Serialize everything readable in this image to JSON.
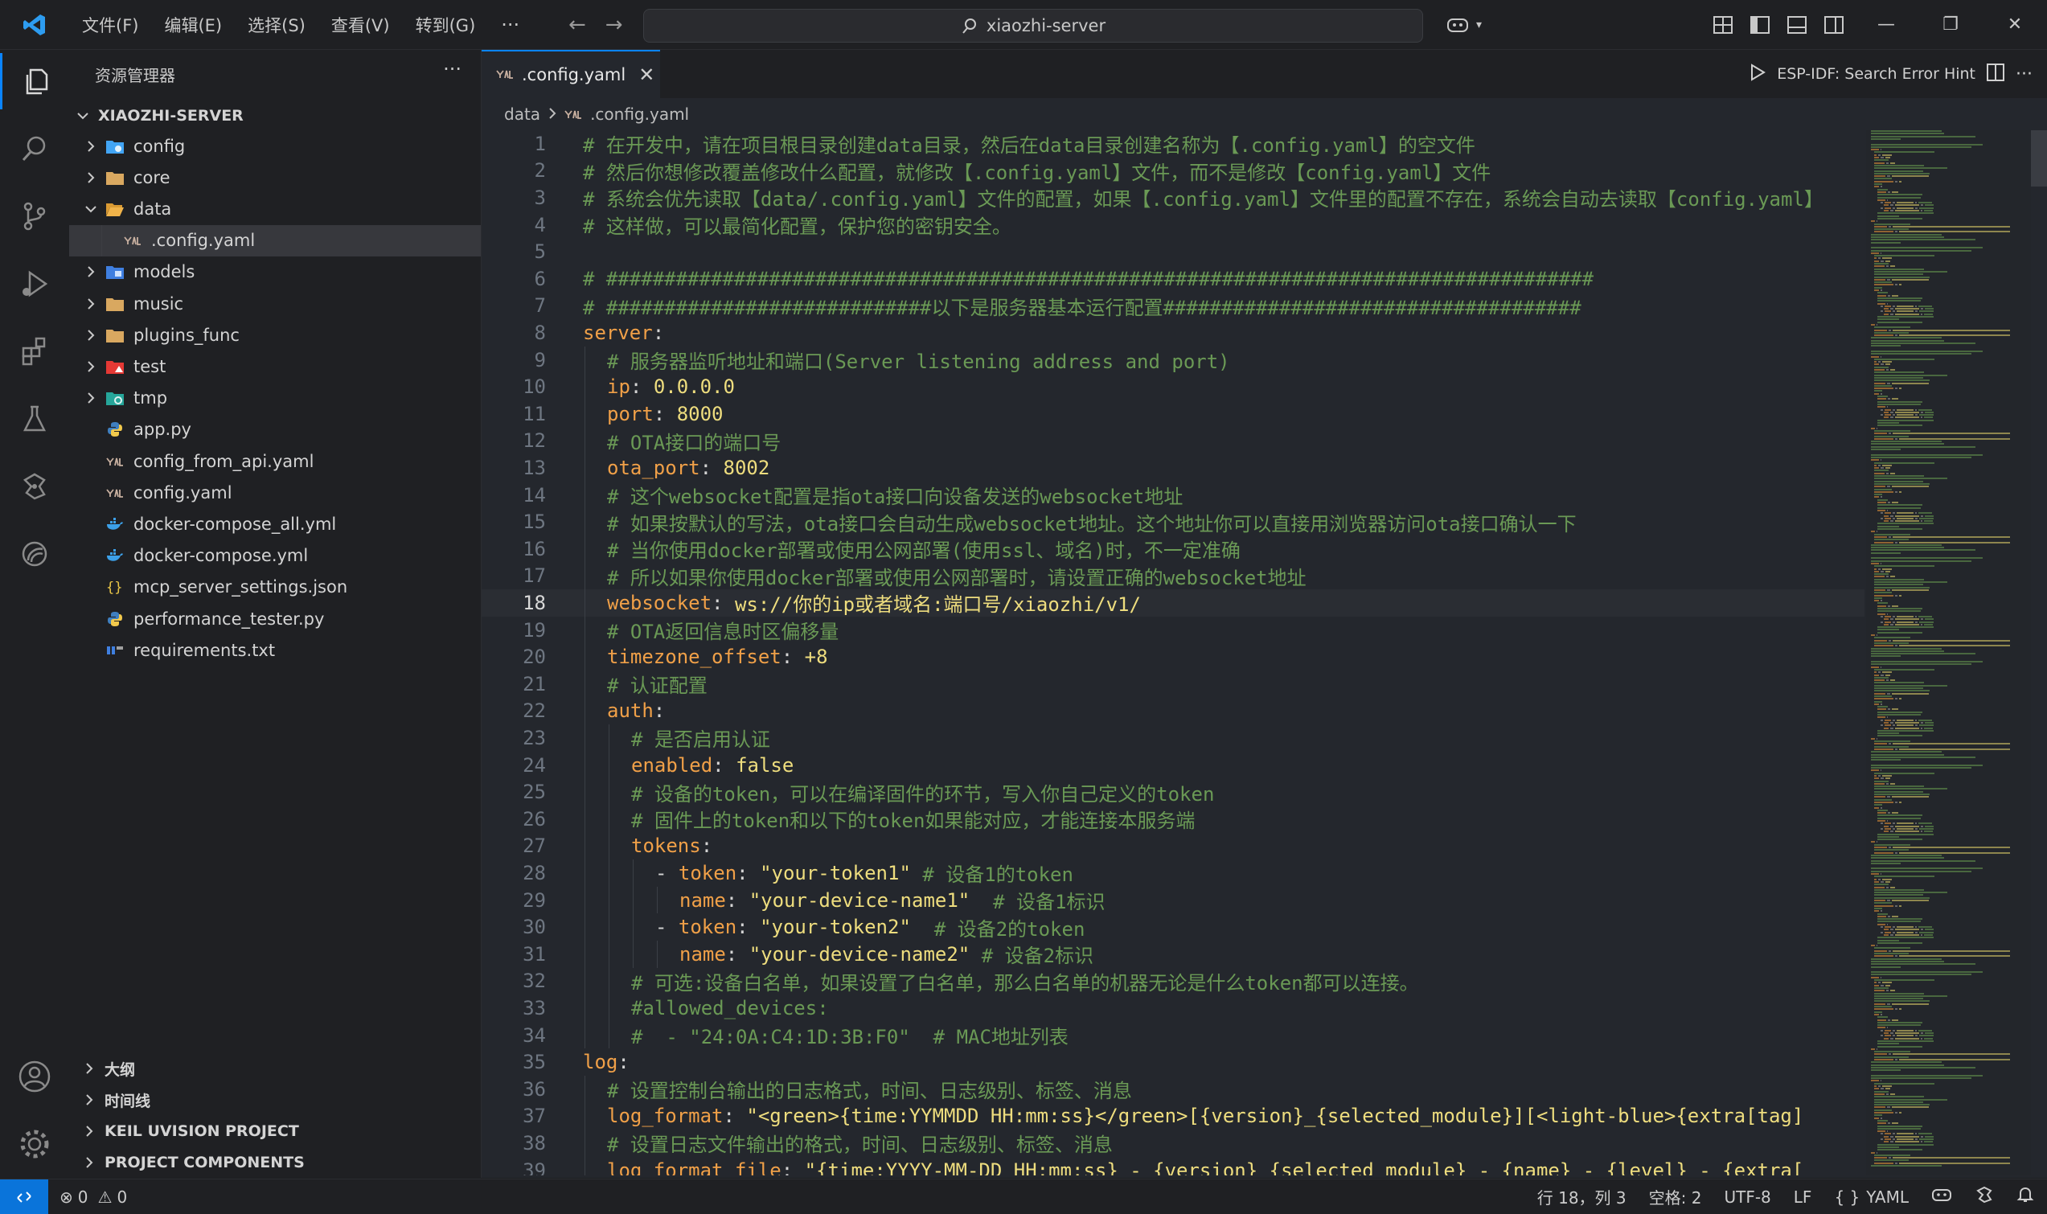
{
  "titlebar": {
    "menus": [
      "文件(F)",
      "编辑(E)",
      "选择(S)",
      "查看(V)",
      "转到(G)"
    ],
    "more": "···",
    "search_text": "xiaozhi-server"
  },
  "sidebar": {
    "title": "资源管理器",
    "more": "···",
    "root": "XIAOZHI-SERVER",
    "items": [
      {
        "label": "config",
        "kind": "folder",
        "icon": "config-folder-icon",
        "color": "#42a5f5",
        "expanded": false
      },
      {
        "label": "core",
        "kind": "folder",
        "icon": "folder-icon",
        "color": "#d9a860",
        "expanded": false
      },
      {
        "label": "data",
        "kind": "folder",
        "icon": "folder-open-icon",
        "color": "#f0b34a",
        "expanded": true
      },
      {
        "label": ".config.yaml",
        "kind": "yaml",
        "icon": "yaml-file-icon",
        "selected": true,
        "depth": 1
      },
      {
        "label": "models",
        "kind": "folder",
        "icon": "models-folder-icon",
        "color": "#3f7fe0",
        "expanded": false
      },
      {
        "label": "music",
        "kind": "folder",
        "icon": "folder-icon",
        "color": "#d9a860",
        "expanded": false
      },
      {
        "label": "plugins_func",
        "kind": "folder",
        "icon": "folder-icon",
        "color": "#d9a860",
        "expanded": false
      },
      {
        "label": "test",
        "kind": "folder",
        "icon": "test-folder-icon",
        "color": "#e53935",
        "expanded": false
      },
      {
        "label": "tmp",
        "kind": "folder",
        "icon": "tmp-folder-icon",
        "color": "#26a69a",
        "expanded": false
      },
      {
        "label": "app.py",
        "kind": "python",
        "icon": "python-file-icon"
      },
      {
        "label": "config_from_api.yaml",
        "kind": "yaml",
        "icon": "yaml-file-icon"
      },
      {
        "label": "config.yaml",
        "kind": "yaml",
        "icon": "yaml-file-icon"
      },
      {
        "label": "docker-compose_all.yml",
        "kind": "docker",
        "icon": "docker-file-icon"
      },
      {
        "label": "docker-compose.yml",
        "kind": "docker",
        "icon": "docker-file-icon"
      },
      {
        "label": "mcp_server_settings.json",
        "kind": "json",
        "icon": "json-file-icon"
      },
      {
        "label": "performance_tester.py",
        "kind": "python",
        "icon": "python-file-icon"
      },
      {
        "label": "requirements.txt",
        "kind": "txt",
        "icon": "requirements-file-icon"
      }
    ],
    "sections": [
      "大纲",
      "时间线",
      "KEIL UVISION PROJECT",
      "PROJECT COMPONENTS"
    ]
  },
  "editor": {
    "tab_label": ".config.yaml",
    "tab_close": "✕",
    "action_label": "ESP-IDF: Search Error Hint",
    "more": "···",
    "breadcrumb": [
      "data",
      ".config.yaml"
    ],
    "current_line": 18,
    "lines": [
      {
        "n": 1,
        "indent": 0,
        "tokens": [
          [
            "cm",
            "# 在开发中，请在项目根目录创建data目录，然后在data目录创建名称为【.config.yaml】的空文件"
          ]
        ]
      },
      {
        "n": 2,
        "indent": 0,
        "tokens": [
          [
            "cm",
            "# 然后你想修改覆盖修改什么配置，就修改【.config.yaml】文件，而不是修改【config.yaml】文件"
          ]
        ]
      },
      {
        "n": 3,
        "indent": 0,
        "tokens": [
          [
            "cm",
            "# 系统会优先读取【data/.config.yaml】文件的配置，如果【.config.yaml】文件里的配置不存在，系统会自动去读取【config.yaml】"
          ]
        ]
      },
      {
        "n": 4,
        "indent": 0,
        "tokens": [
          [
            "cm",
            "# 这样做，可以最简化配置，保护您的密钥安全。"
          ]
        ]
      },
      {
        "n": 5,
        "indent": 0,
        "tokens": []
      },
      {
        "n": 6,
        "indent": 0,
        "tokens": [
          [
            "cm",
            "# #####################################################################################"
          ]
        ]
      },
      {
        "n": 7,
        "indent": 0,
        "tokens": [
          [
            "cm",
            "# ############################以下是服务器基本运行配置####################################"
          ]
        ]
      },
      {
        "n": 8,
        "indent": 0,
        "tokens": [
          [
            "ky",
            "server"
          ],
          [
            "pn",
            ":"
          ]
        ]
      },
      {
        "n": 9,
        "indent": 1,
        "tokens": [
          [
            "cm",
            "# 服务器监听地址和端口(Server listening address and port)"
          ]
        ]
      },
      {
        "n": 10,
        "indent": 1,
        "tokens": [
          [
            "ky",
            "ip"
          ],
          [
            "pn",
            ": "
          ],
          [
            "vn",
            "0.0.0.0"
          ]
        ]
      },
      {
        "n": 11,
        "indent": 1,
        "tokens": [
          [
            "ky",
            "port"
          ],
          [
            "pn",
            ": "
          ],
          [
            "vn",
            "8000"
          ]
        ]
      },
      {
        "n": 12,
        "indent": 1,
        "tokens": [
          [
            "cm",
            "# OTA接口的端口号"
          ]
        ]
      },
      {
        "n": 13,
        "indent": 1,
        "tokens": [
          [
            "ky",
            "ota_port"
          ],
          [
            "pn",
            ": "
          ],
          [
            "vn",
            "8002"
          ]
        ]
      },
      {
        "n": 14,
        "indent": 1,
        "tokens": [
          [
            "cm",
            "# 这个websocket配置是指ota接口向设备发送的websocket地址"
          ]
        ]
      },
      {
        "n": 15,
        "indent": 1,
        "tokens": [
          [
            "cm",
            "# 如果按默认的写法，ota接口会自动生成websocket地址。这个地址你可以直接用浏览器访问ota接口确认一下"
          ]
        ]
      },
      {
        "n": 16,
        "indent": 1,
        "tokens": [
          [
            "cm",
            "# 当你使用docker部署或使用公网部署(使用ssl、域名)时，不一定准确"
          ]
        ]
      },
      {
        "n": 17,
        "indent": 1,
        "tokens": [
          [
            "cm",
            "# 所以如果你使用docker部署或使用公网部署时，请设置正确的websocket地址"
          ]
        ]
      },
      {
        "n": 18,
        "indent": 1,
        "tokens": [
          [
            "ky",
            "websocket"
          ],
          [
            "pn",
            ": "
          ],
          [
            "vs",
            "ws://你的ip或者域名:端口号/xiaozhi/v1/"
          ]
        ]
      },
      {
        "n": 19,
        "indent": 1,
        "tokens": [
          [
            "cm",
            "# OTA返回信息时区偏移量"
          ]
        ]
      },
      {
        "n": 20,
        "indent": 1,
        "tokens": [
          [
            "ky",
            "timezone_offset"
          ],
          [
            "pn",
            ": "
          ],
          [
            "vn",
            "+8"
          ]
        ]
      },
      {
        "n": 21,
        "indent": 1,
        "tokens": [
          [
            "cm",
            "# 认证配置"
          ]
        ]
      },
      {
        "n": 22,
        "indent": 1,
        "tokens": [
          [
            "ky",
            "auth"
          ],
          [
            "pn",
            ":"
          ]
        ]
      },
      {
        "n": 23,
        "indent": 2,
        "tokens": [
          [
            "cm",
            "# 是否启用认证"
          ]
        ]
      },
      {
        "n": 24,
        "indent": 2,
        "tokens": [
          [
            "ky",
            "enabled"
          ],
          [
            "pn",
            ": "
          ],
          [
            "vn",
            "false"
          ]
        ]
      },
      {
        "n": 25,
        "indent": 2,
        "tokens": [
          [
            "cm",
            "# 设备的token，可以在编译固件的环节，写入你自己定义的token"
          ]
        ]
      },
      {
        "n": 26,
        "indent": 2,
        "tokens": [
          [
            "cm",
            "# 固件上的token和以下的token如果能对应，才能连接本服务端"
          ]
        ]
      },
      {
        "n": 27,
        "indent": 2,
        "tokens": [
          [
            "ky",
            "tokens"
          ],
          [
            "pn",
            ":"
          ]
        ]
      },
      {
        "n": 28,
        "indent": 3,
        "tokens": [
          [
            "pn",
            "- "
          ],
          [
            "ky",
            "token"
          ],
          [
            "pn",
            ": "
          ],
          [
            "vs",
            "\"your-token1\""
          ],
          [
            "pn",
            " "
          ],
          [
            "cm",
            "# 设备1的token"
          ]
        ]
      },
      {
        "n": 29,
        "indent": 4,
        "tokens": [
          [
            "ky",
            "name"
          ],
          [
            "pn",
            ": "
          ],
          [
            "vs",
            "\"your-device-name1\""
          ],
          [
            "pn",
            "  "
          ],
          [
            "cm",
            "# 设备1标识"
          ]
        ]
      },
      {
        "n": 30,
        "indent": 3,
        "tokens": [
          [
            "pn",
            "- "
          ],
          [
            "ky",
            "token"
          ],
          [
            "pn",
            ": "
          ],
          [
            "vs",
            "\"your-token2\""
          ],
          [
            "pn",
            "  "
          ],
          [
            "cm",
            "# 设备2的token"
          ]
        ]
      },
      {
        "n": 31,
        "indent": 4,
        "tokens": [
          [
            "ky",
            "name"
          ],
          [
            "pn",
            ": "
          ],
          [
            "vs",
            "\"your-device-name2\""
          ],
          [
            "pn",
            " "
          ],
          [
            "cm",
            "# 设备2标识"
          ]
        ]
      },
      {
        "n": 32,
        "indent": 2,
        "tokens": [
          [
            "cm",
            "# 可选:设备白名单，如果设置了白名单，那么白名单的机器无论是什么token都可以连接。"
          ]
        ]
      },
      {
        "n": 33,
        "indent": 2,
        "tokens": [
          [
            "cm",
            "#allowed_devices:"
          ]
        ]
      },
      {
        "n": 34,
        "indent": 2,
        "tokens": [
          [
            "cm",
            "#  - \"24:0A:C4:1D:3B:F0\"  # MAC地址列表"
          ]
        ]
      },
      {
        "n": 35,
        "indent": 0,
        "tokens": [
          [
            "ky",
            "log"
          ],
          [
            "pn",
            ":"
          ]
        ]
      },
      {
        "n": 36,
        "indent": 1,
        "tokens": [
          [
            "cm",
            "# 设置控制台输出的日志格式，时间、日志级别、标签、消息"
          ]
        ]
      },
      {
        "n": 37,
        "indent": 1,
        "tokens": [
          [
            "ky",
            "log_format"
          ],
          [
            "pn",
            ": "
          ],
          [
            "vs",
            "\"<green>{time:YYMMDD HH:mm:ss}</green>[{version}_{selected_module}][<light-blue>{extra[tag]"
          ]
        ]
      },
      {
        "n": 38,
        "indent": 1,
        "tokens": [
          [
            "cm",
            "# 设置日志文件输出的格式，时间、日志级别、标签、消息"
          ]
        ]
      },
      {
        "n": 39,
        "indent": 1,
        "tokens": [
          [
            "ky",
            "log_format_file"
          ],
          [
            "pn",
            ": "
          ],
          [
            "vs",
            "\"{time:YYYY-MM-DD HH:mm:ss} - {version}_{selected_module} - {name} - {level} - {extra["
          ]
        ]
      }
    ]
  },
  "statusbar": {
    "errors": "0",
    "warnings": "0",
    "position": "行 18，列 3",
    "spaces": "空格: 2",
    "encoding": "UTF-8",
    "eol": "LF",
    "language_icon": "{ }",
    "language": "YAML"
  },
  "colors": {
    "accent": "#0a84ff",
    "comment": "#6a9955",
    "key": "#f0a048",
    "string": "#eedd7e"
  }
}
